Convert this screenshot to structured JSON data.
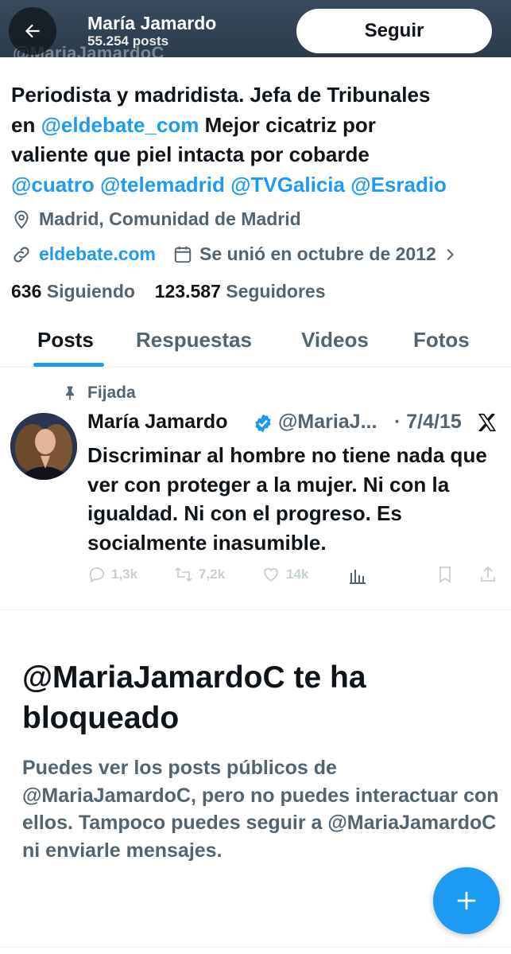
{
  "header": {
    "name": "María Jamardo",
    "post_count": "55.254 posts",
    "follow_label": "Seguir",
    "ghost_handle": "@MariaJamardoC"
  },
  "profile": {
    "bio_line1": "Periodista y madridista. Jefa de Tribunales",
    "bio_en": "en",
    "bio_mention_eldebate": "@eldebate_com",
    "bio_line2_rest": "Mejor cicatriz por",
    "bio_line3": "valiente que piel intacta por cobarde",
    "bio_mentions": [
      "@cuatro",
      "@telemadrid",
      "@TVGalicia",
      "@Esradio"
    ],
    "location": "Madrid, Comunidad de Madrid",
    "website": "eldebate.com",
    "joined": "Se unió en octubre de 2012",
    "following_count": "636",
    "following_label": "Siguiendo",
    "followers_count": "123.587",
    "followers_label": "Seguidores"
  },
  "tabs": [
    "Posts",
    "Respuestas",
    "Videos",
    "Fotos"
  ],
  "pinned_tweet": {
    "pinned_label": "Fijada",
    "author_name": "María Jamardo",
    "handle": "@MariaJ...",
    "date": "· 7/4/15",
    "text": "Discriminar al hombre no tiene nada que ver con proteger a la mujer. Ni con la igualdad. Ni con el progreso. Es socialmente inasumible.",
    "replies": "1,3k",
    "retweets": "7,2k",
    "likes": "14k"
  },
  "blocked": {
    "title": "@MariaJamardoC te ha bloqueado",
    "description": "Puedes ver los posts públicos de @MariaJamardoC, pero no puedes interactuar con ellos. Tampoco puedes seguir a @MariaJamardoC ni enviarle mensajes."
  },
  "colors": {
    "accent": "#1d9bf0",
    "text_primary": "#0f1419",
    "text_secondary": "#536471",
    "header_bg": "#33475b"
  },
  "icons": [
    "back-arrow-icon",
    "location-pin-icon",
    "link-icon",
    "calendar-icon",
    "chevron-right-icon",
    "pin-icon",
    "verified-badge-icon",
    "x-logo-icon",
    "reply-icon",
    "retweet-icon",
    "like-icon",
    "views-icon",
    "bookmark-icon",
    "share-icon",
    "plus-icon"
  ]
}
